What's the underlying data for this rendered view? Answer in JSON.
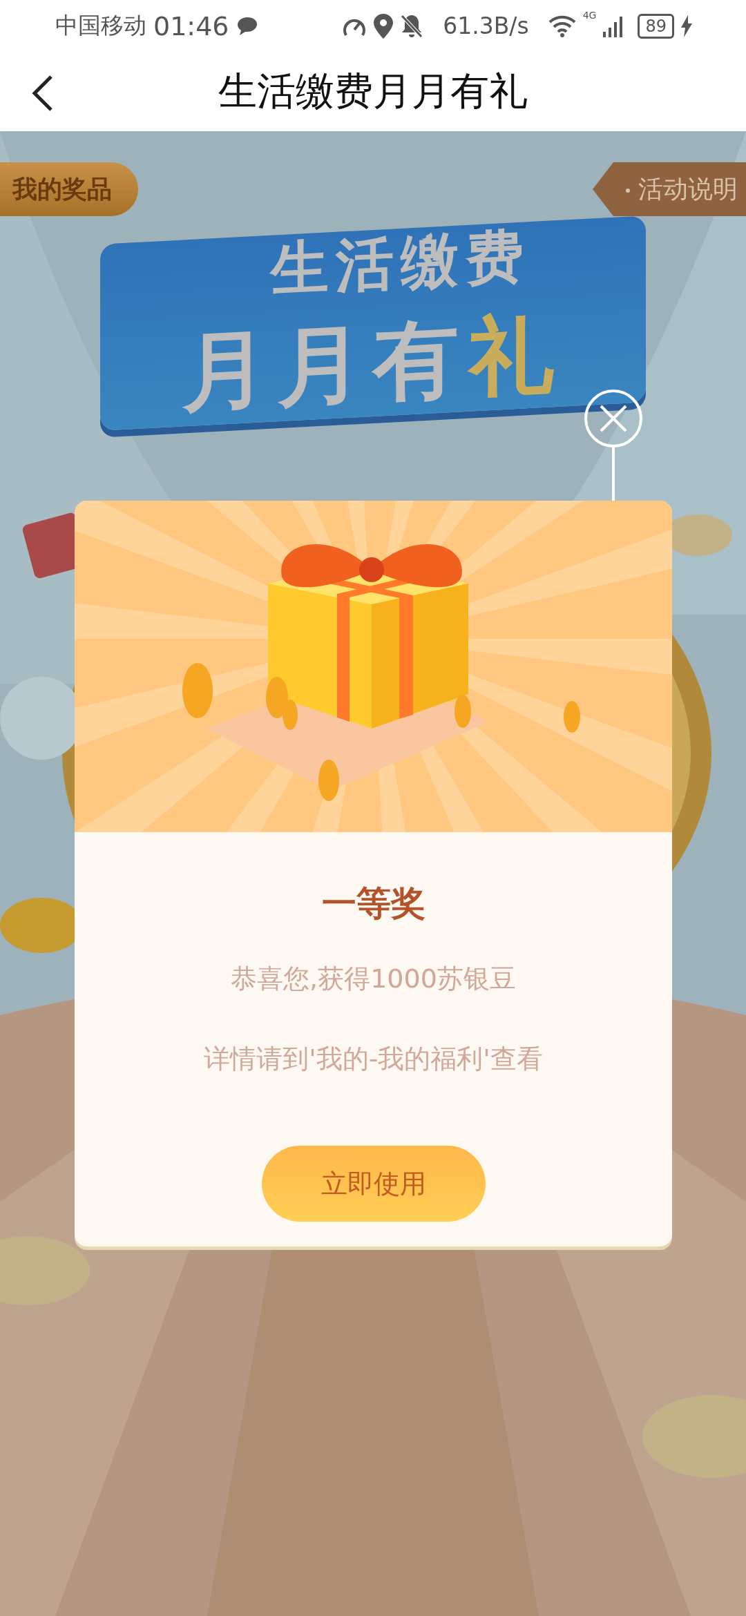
{
  "status_bar": {
    "carrier": "中国移动",
    "time": "01:46",
    "network_speed": "61.3B/s",
    "network_type": "4G",
    "battery": "89"
  },
  "nav": {
    "title": "生活缴费月月有礼"
  },
  "page": {
    "my_prizes_button": "我的奖品",
    "rules_button": "活动说明",
    "banner": {
      "line_1": "生活缴费",
      "line_2_main": "月月有",
      "line_2_accent": "礼"
    }
  },
  "dialog": {
    "prize": "一等奖",
    "message": "恭喜您,获得1000苏银豆",
    "hint": "详情请到'我的-我的福利'查看",
    "button": "立即使用"
  }
}
